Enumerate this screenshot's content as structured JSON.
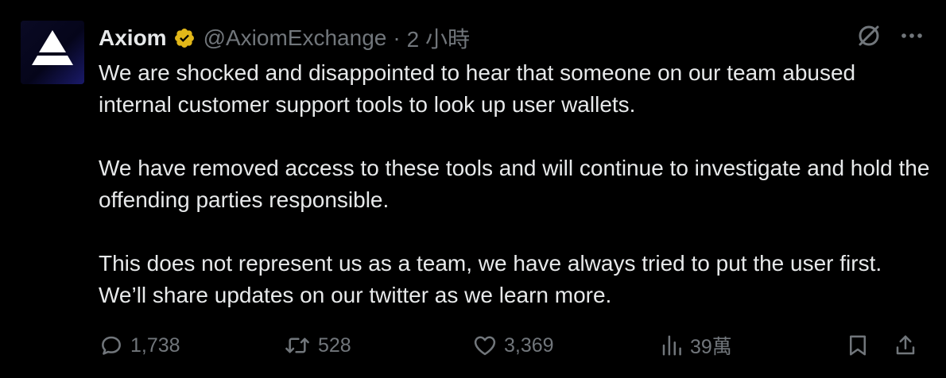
{
  "tweet": {
    "author": {
      "name": "Axiom",
      "handle": "@AxiomExchange",
      "verified": true,
      "verified_color": "#e2b719"
    },
    "separator": "·",
    "timestamp": "2 小時",
    "body": {
      "paragraphs": [
        "We are shocked and disappointed to hear that someone on our team abused internal customer support tools to look up user wallets.",
        "We have removed access to these tools and will continue to investigate and hold the offending parties responsible.",
        "This does not represent us as a team, we have always tried to put the user first. We’ll share updates on our twitter as we learn more."
      ]
    },
    "top_actions": {
      "grok_icon": "grok-icon",
      "more_icon": "more-icon"
    },
    "actions": {
      "replies": "1,738",
      "reposts": "528",
      "likes": "3,369",
      "views": "39萬"
    }
  },
  "theme": {
    "background": "#000000",
    "text": "#e7e9ea",
    "muted": "#71767b"
  }
}
